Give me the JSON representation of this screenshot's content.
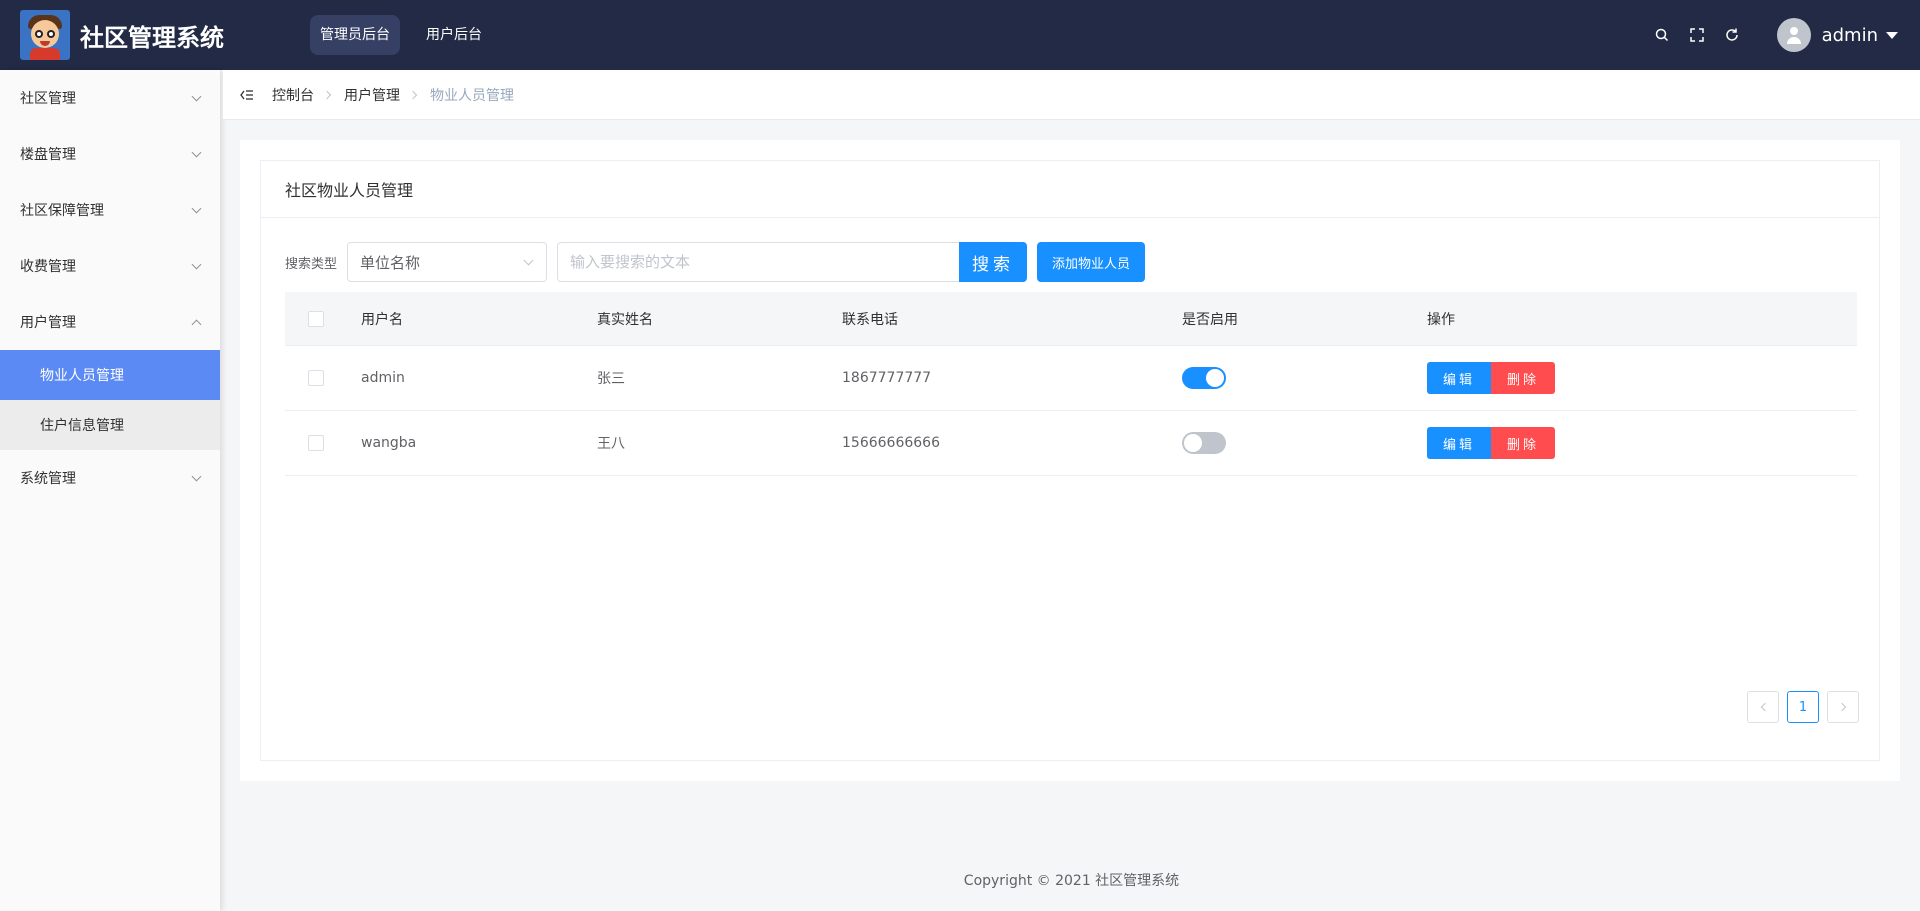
{
  "header": {
    "title": "社区管理系统",
    "nav": [
      {
        "label": "管理员后台",
        "active": true
      },
      {
        "label": "用户后台",
        "active": false
      }
    ],
    "username": "admin"
  },
  "sidebar": {
    "items": [
      {
        "label": "社区管理"
      },
      {
        "label": "楼盘管理"
      },
      {
        "label": "社区保障管理"
      },
      {
        "label": "收费管理"
      },
      {
        "label": "用户管理",
        "children": [
          {
            "label": "物业人员管理",
            "active": true
          },
          {
            "label": "住户信息管理"
          }
        ]
      },
      {
        "label": "系统管理"
      }
    ]
  },
  "breadcrumb": [
    "控制台",
    "用户管理",
    "物业人员管理"
  ],
  "card": {
    "title": "社区物业人员管理"
  },
  "search": {
    "type_label": "搜索类型",
    "type_selected": "单位名称",
    "placeholder": "输入要搜索的文本",
    "value": "",
    "search_button": "搜索",
    "add_button": "添加物业人员"
  },
  "table": {
    "headers": [
      "用户名",
      "真实姓名",
      "联系电话",
      "是否启用",
      "操作"
    ],
    "rows": [
      {
        "username": "admin",
        "realname": "张三",
        "phone": "1867777777",
        "enabled": true
      },
      {
        "username": "wangba",
        "realname": "王八",
        "phone": "15666666666",
        "enabled": false
      }
    ],
    "edit_label": "编辑",
    "delete_label": "删除"
  },
  "pagination": {
    "current": "1"
  },
  "footer": "Copyright © 2021 社区管理系统",
  "colors": {
    "header_bg": "#222a45",
    "primary": "#1890ff",
    "danger": "#ff4d4f",
    "sidebar_active": "#5b8af4"
  }
}
